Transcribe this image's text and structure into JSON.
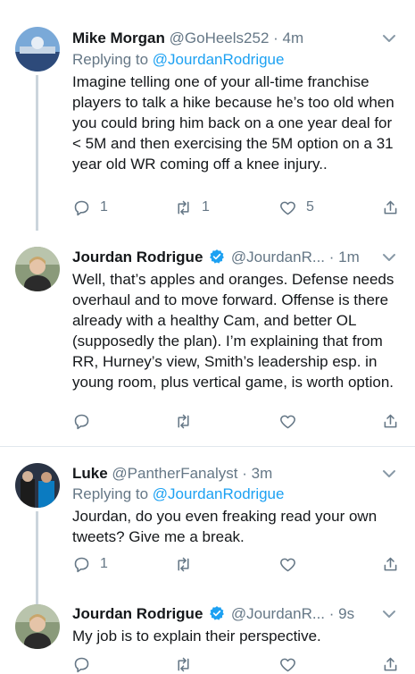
{
  "tweets": [
    {
      "name": "Mike Morgan",
      "handle": "@GoHeels252",
      "dot": "·",
      "time": "4m",
      "replying_prefix": "Replying to ",
      "replying_handle": "@JourdanRodrigue",
      "text": "Imagine telling one of your all-time franchise players to talk a hike because he’s too old when you could bring him back on a one year deal for < 5M and then exercising the 5M option on a 31 year old WR coming off a knee injury..",
      "reply_count": "1",
      "retweet_count": "1",
      "like_count": "5"
    },
    {
      "name": "Jourdan Rodrigue",
      "handle": "@JourdanR...",
      "dot": "·",
      "time": "1m",
      "verified": true,
      "text": "Well, that’s apples and oranges. Defense needs overhaul and to move forward. Offense is there already with a healthy Cam, and better OL (supposedly the plan). I’m explaining that from RR, Hurney’s view, Smith’s leadership esp. in young room, plus vertical game, is worth option.",
      "reply_count": "",
      "retweet_count": "",
      "like_count": ""
    },
    {
      "name": "Luke",
      "handle": "@PantherFanalyst",
      "dot": "·",
      "time": "3m",
      "replying_prefix": "Replying to ",
      "replying_handle": "@JourdanRodrigue",
      "text": "Jourdan, do you even freaking read your own tweets? Give me a break.",
      "reply_count": "1",
      "retweet_count": "",
      "like_count": ""
    },
    {
      "name": "Jourdan Rodrigue",
      "handle": "@JourdanR...",
      "dot": "·",
      "time": "9s",
      "verified": true,
      "text": "My job is to explain their perspective."
    }
  ],
  "colors": {
    "accent": "#1da1f2",
    "muted": "#657786",
    "divider": "#e1e8ed",
    "thread": "#cbd5dc"
  },
  "icons": [
    "chevron-down-icon",
    "reply-icon",
    "retweet-icon",
    "like-icon",
    "share-icon",
    "verified-badge-icon"
  ]
}
